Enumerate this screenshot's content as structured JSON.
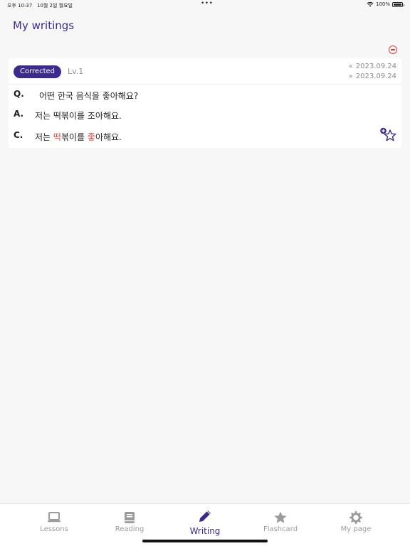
{
  "status_bar": {
    "time": "오후 10:37",
    "date": "10월 2일 월요일",
    "dots": "•••",
    "battery": "100%"
  },
  "header": {
    "title": "My writings"
  },
  "entries": [
    {
      "status": "Corrected",
      "level": "Lv.1",
      "date_start": "2023.09.24",
      "date_end": "2023.09.24",
      "date_start_arrow": "«",
      "date_end_arrow": "»",
      "question_key": "Q.",
      "question": "어떤 한국 음식을 좋아해요?",
      "answer_key": "A.",
      "answer": "저는 떡볶이를 조아해요.",
      "correction_key": "C.",
      "correction_parts": {
        "p1": "저는 ",
        "h1": "떡",
        "p2": "볶이를 ",
        "h2": "좋",
        "p3": "아해요."
      }
    }
  ],
  "tab_bar": {
    "tabs": [
      {
        "label": "Lessons",
        "icon": "laptop-icon"
      },
      {
        "label": "Reading",
        "icon": "book-icon"
      },
      {
        "label": "Writing",
        "icon": "pencil-icon",
        "active": true
      },
      {
        "label": "Flashcard",
        "icon": "star-icon"
      },
      {
        "label": "My page",
        "icon": "gear-icon"
      }
    ]
  },
  "colors": {
    "accent": "#3d2a8f",
    "highlight": "#e0413a",
    "inactive": "#9b9b9b",
    "background": "#f7f7f8"
  }
}
